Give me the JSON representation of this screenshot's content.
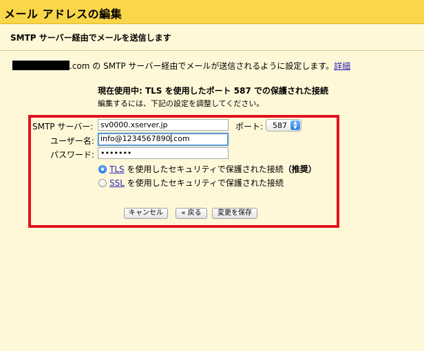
{
  "window": {
    "title": "メール アドレスの編集"
  },
  "header": {
    "subtitle": "SMTP サーバー経由でメールを送信します"
  },
  "description": {
    "domain_suffix": ".com",
    "text": " の SMTP サーバー経由でメールが送信されるように設定します。",
    "link": "詳細"
  },
  "status": {
    "title": "現在使用中: TLS を使用したポート 587 での保護された接続",
    "subtitle": "編集するには、下記の設定を調整してください。"
  },
  "form": {
    "smtp_label": "SMTP サーバー:",
    "smtp_value": "sv0000.xserver.jp",
    "port_label": "ポート:",
    "port_value": "587",
    "user_label": "ユーザー名:",
    "user_value": "info@1234567890",
    "user_value_after_caret": ".com",
    "password_label": "パスワード:",
    "password_value": "•••••••",
    "tls_link": "TLS",
    "tls_text": " を使用したセキュリティで保護された接続",
    "tls_recommended": "（推奨）",
    "ssl_link": "SSL",
    "ssl_text": " を使用したセキュリティで保護された接続",
    "selected": "TLS"
  },
  "buttons": {
    "cancel": "キャンセル",
    "back": "« 戻る",
    "save": "変更を保存"
  },
  "colors": {
    "titlebar": "#f9d64a",
    "background": "#fff8d8",
    "highlight_border": "#e1121f",
    "link": "#2a22b8"
  }
}
